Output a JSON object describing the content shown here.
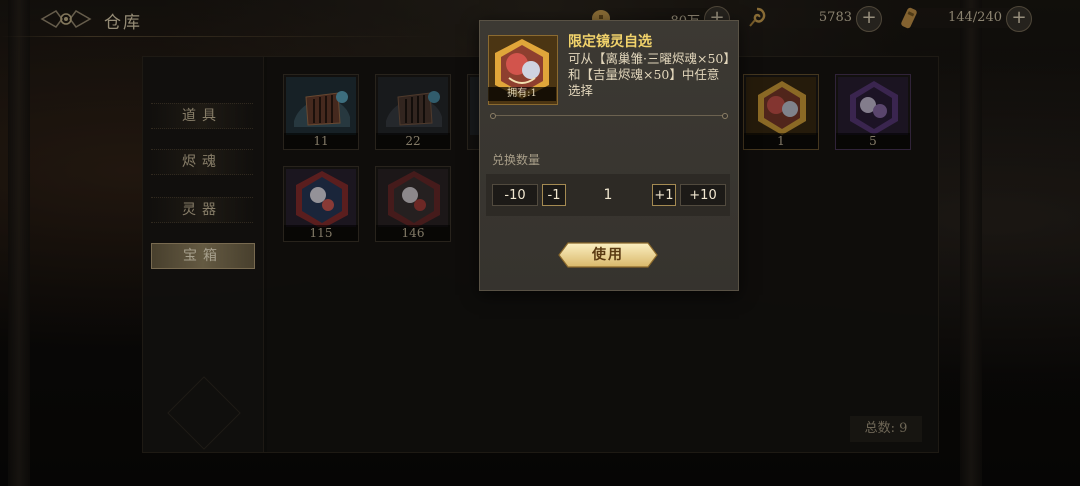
{
  "header": {
    "title": "仓库",
    "back_icon": "winged-emblem-icon"
  },
  "resources": [
    {
      "name": "coin",
      "icon": "coin-icon",
      "value": "80万"
    },
    {
      "name": "jade",
      "icon": "spiral-jade-icon",
      "value": "5783"
    },
    {
      "name": "stamina",
      "icon": "scroll-gourd-icon",
      "value": "144/240"
    }
  ],
  "tabs": [
    {
      "label": "道具",
      "active": false
    },
    {
      "label": "烬魂",
      "active": false
    },
    {
      "label": "灵器",
      "active": false
    },
    {
      "label": "宝箱",
      "active": true
    }
  ],
  "items": [
    {
      "qty": "11",
      "art": "blue-treasure-box"
    },
    {
      "qty": "22",
      "art": "dark-treasure-box"
    },
    {
      "qty": "1",
      "art": "golden-portrait-chest"
    },
    {
      "qty": "5",
      "art": "purple-portrait-chest"
    },
    {
      "qty": "115",
      "art": "red-blue-chest"
    },
    {
      "qty": "146",
      "art": "red-dark-chest"
    }
  ],
  "total_label": "总数: 9",
  "popup": {
    "item_name": "限定镜灵自选",
    "owned": "拥有:1",
    "description": "可从【离巢雏·三曜烬魂×50】和【吉量烬魂×50】中任意选择",
    "exchange_label": "兑换数量",
    "btn_minus10": "-10",
    "btn_minus1": "-1",
    "quantity": "1",
    "btn_plus1": "+1",
    "btn_plus10": "+10",
    "use_label": "使用"
  },
  "colors": {
    "accent_gold": "#f2d36b",
    "tab_active": "#9a8a66",
    "popup_bg": "#3c3933"
  }
}
